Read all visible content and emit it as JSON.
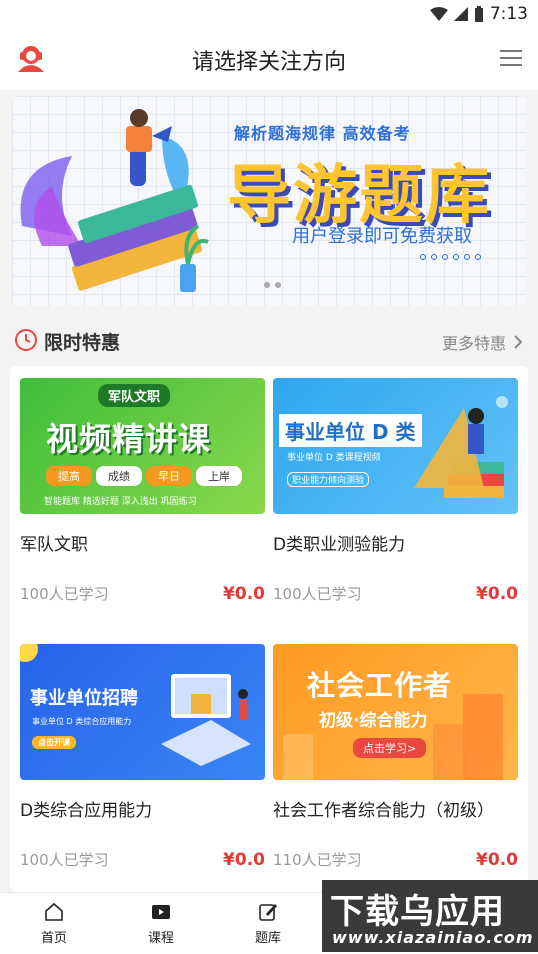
{
  "status_bar": {
    "time": "7:13"
  },
  "header": {
    "title": "请选择关注方向"
  },
  "banner": {
    "tagline": "解析题海规律  高效备考",
    "main_title": "导游题库",
    "subtitle": "用户登录即可免费获取"
  },
  "section": {
    "title": "限时特惠",
    "more_label": "更多特惠"
  },
  "courses": [
    {
      "name": "军队文职",
      "learners": "100人已学习",
      "price": "¥0.0",
      "thumb": {
        "badge": "军队文职",
        "headline": "视频精讲课",
        "pills": [
          "提高",
          "成绩",
          "早日",
          "上岸"
        ],
        "footer": "智能题库  精选好题  深入浅出  巩固练习"
      }
    },
    {
      "name": "D类职业测验能力",
      "learners": "100人已学习",
      "price": "¥0.0",
      "thumb": {
        "headline": "事业单位 D 类",
        "line1": "事业单位  D 类课程视频",
        "line2": "职业能力倾向测验"
      }
    },
    {
      "name": "D类综合应用能力",
      "learners": "100人已学习",
      "price": "¥0.0",
      "thumb": {
        "headline": "事业单位招聘",
        "line1": "事业单位 D 类综合应用能力",
        "cta": "点击开课"
      }
    },
    {
      "name": "社会工作者综合能力（初级）",
      "learners": "110人已学习",
      "price": "¥0.0",
      "thumb": {
        "headline": "社会工作者",
        "line1": "初级·综合能力",
        "cta": "点击学习>"
      }
    }
  ],
  "bottom_nav": [
    {
      "label": "首页",
      "icon": "home-icon"
    },
    {
      "label": "课程",
      "icon": "video-icon"
    },
    {
      "label": "题库",
      "icon": "edit-icon"
    }
  ],
  "watermark": {
    "main": "下载乌应用",
    "sub": "www.xiazainiao.com"
  },
  "colors": {
    "price": "#e53935",
    "accent": "#e8483f",
    "banner_yellow": "#ffc531"
  }
}
